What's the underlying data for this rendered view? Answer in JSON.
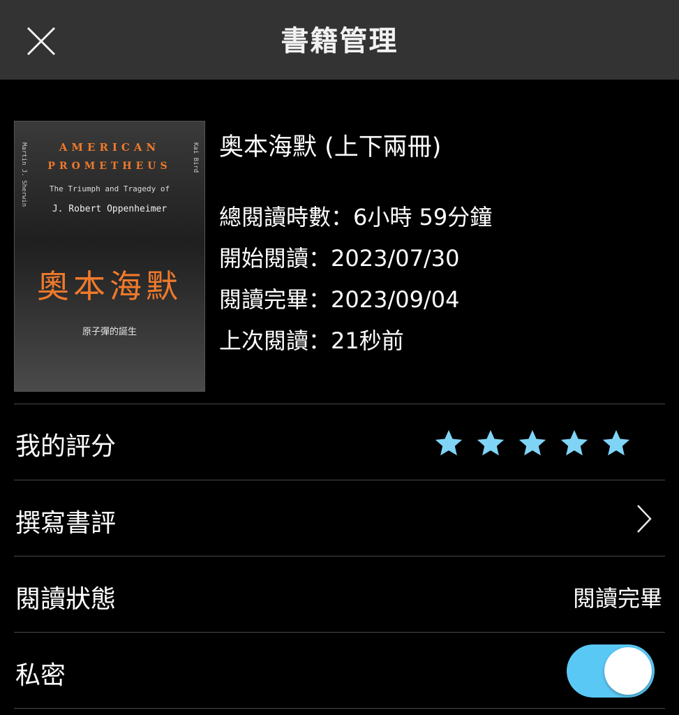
{
  "header": {
    "title": "書籍管理",
    "close_icon": "close-icon"
  },
  "book": {
    "title": "奥本海默 (上下兩冊)",
    "cover": {
      "en_title_1": "AMERICAN",
      "en_title_2": "PROMETHEUS",
      "en_subtitle": "The Triumph and Tragedy of",
      "en_name": "J. Robert Oppenheimer",
      "zh_title": "奧本海默",
      "zh_subtitle": "原子彈的誕生"
    },
    "total_reading_time": "總閱讀時數：6小時 59分鐘",
    "start_reading": "開始閱讀：2023/07/30",
    "finished_reading": "閱讀完畢：2023/09/04",
    "last_read": "上次閱讀：21秒前"
  },
  "rating": {
    "label": "我的評分",
    "stars": 5,
    "max_stars": 5,
    "star_color": "#7fd4f5"
  },
  "review": {
    "label": "撰寫書評",
    "icon": "chevron-right-icon"
  },
  "reading_status": {
    "label": "閱讀狀態",
    "value": "閱讀完畢"
  },
  "private": {
    "label": "私密",
    "enabled": true,
    "toggle_color": "#5ac8f5"
  }
}
